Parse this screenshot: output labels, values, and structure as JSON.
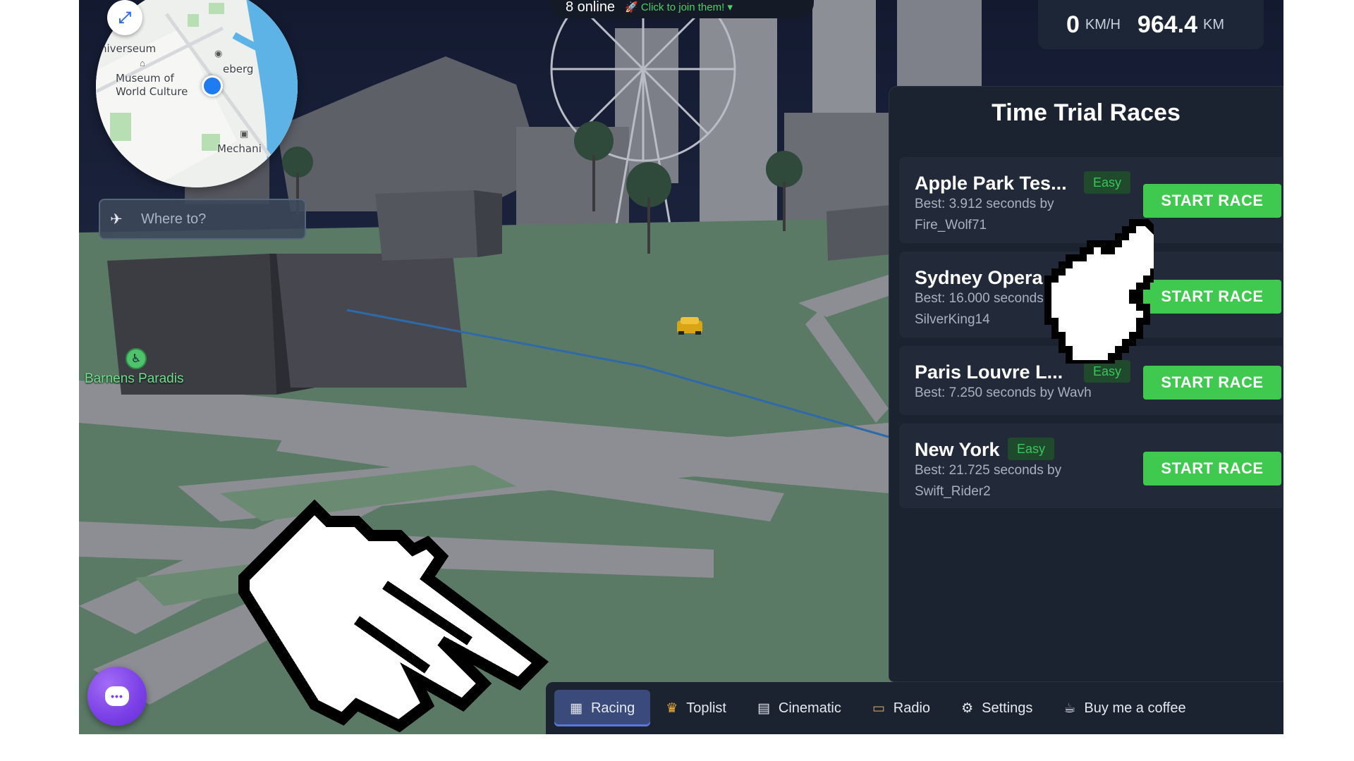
{
  "minimap": {
    "expand_icon": "⤢",
    "labels": {
      "universeum": "niverseum",
      "museum": "Museum of\nWorld Culture",
      "liseberg": "eberg",
      "mechanic": "Mechani"
    }
  },
  "search": {
    "placeholder": "Where to?",
    "icon": "airplane-icon"
  },
  "poi": {
    "label": "Barnens Paradis",
    "icon": "accessibility-icon"
  },
  "online": {
    "count_text": "8 online",
    "invite_text": "🚀 Click to join them! ▾"
  },
  "speedometer": {
    "speed": "0",
    "speed_unit": "KM/H",
    "distance": "964.4",
    "distance_unit": "KM"
  },
  "race_panel": {
    "title": "Time Trial Races",
    "races": [
      {
        "name": "Apple Park Tes...",
        "difficulty": "Easy",
        "best_line1": "Best: 3.912 seconds by",
        "best_line2": "Fire_Wolf71",
        "button": "START RACE"
      },
      {
        "name": "Sydney Opera ...",
        "difficulty": "",
        "best_line1": "Best: 16.000 seconds by",
        "best_line2": "SilverKing14",
        "button": "START RACE"
      },
      {
        "name": "Paris Louvre L...",
        "difficulty": "Easy",
        "best_line1": "Best: 7.250 seconds by Wavh",
        "best_line2": "",
        "button": "START RACE"
      },
      {
        "name": "New York",
        "difficulty": "Easy",
        "best_line1": "Best: 21.725 seconds by",
        "best_line2": "Swift_Rider2",
        "button": "START RACE"
      }
    ]
  },
  "chat": {
    "icon": "chat-icon"
  },
  "nav": {
    "items": [
      {
        "label": "Racing",
        "icon": "checkered-flag-icon",
        "active": true
      },
      {
        "label": "Toplist",
        "icon": "trophy-icon",
        "active": false
      },
      {
        "label": "Cinematic",
        "icon": "clapperboard-icon",
        "active": false
      },
      {
        "label": "Radio",
        "icon": "radio-icon",
        "active": false
      },
      {
        "label": "Settings",
        "icon": "gear-icon",
        "active": false
      },
      {
        "label": "Buy me a coffee",
        "icon": "coffee-icon",
        "active": false
      }
    ]
  },
  "colors": {
    "sky": "#1c2540",
    "ground": "#5a7a64",
    "road": "#8e8e95",
    "accent_green": "#3fc94f",
    "panel": "#1b2230"
  }
}
